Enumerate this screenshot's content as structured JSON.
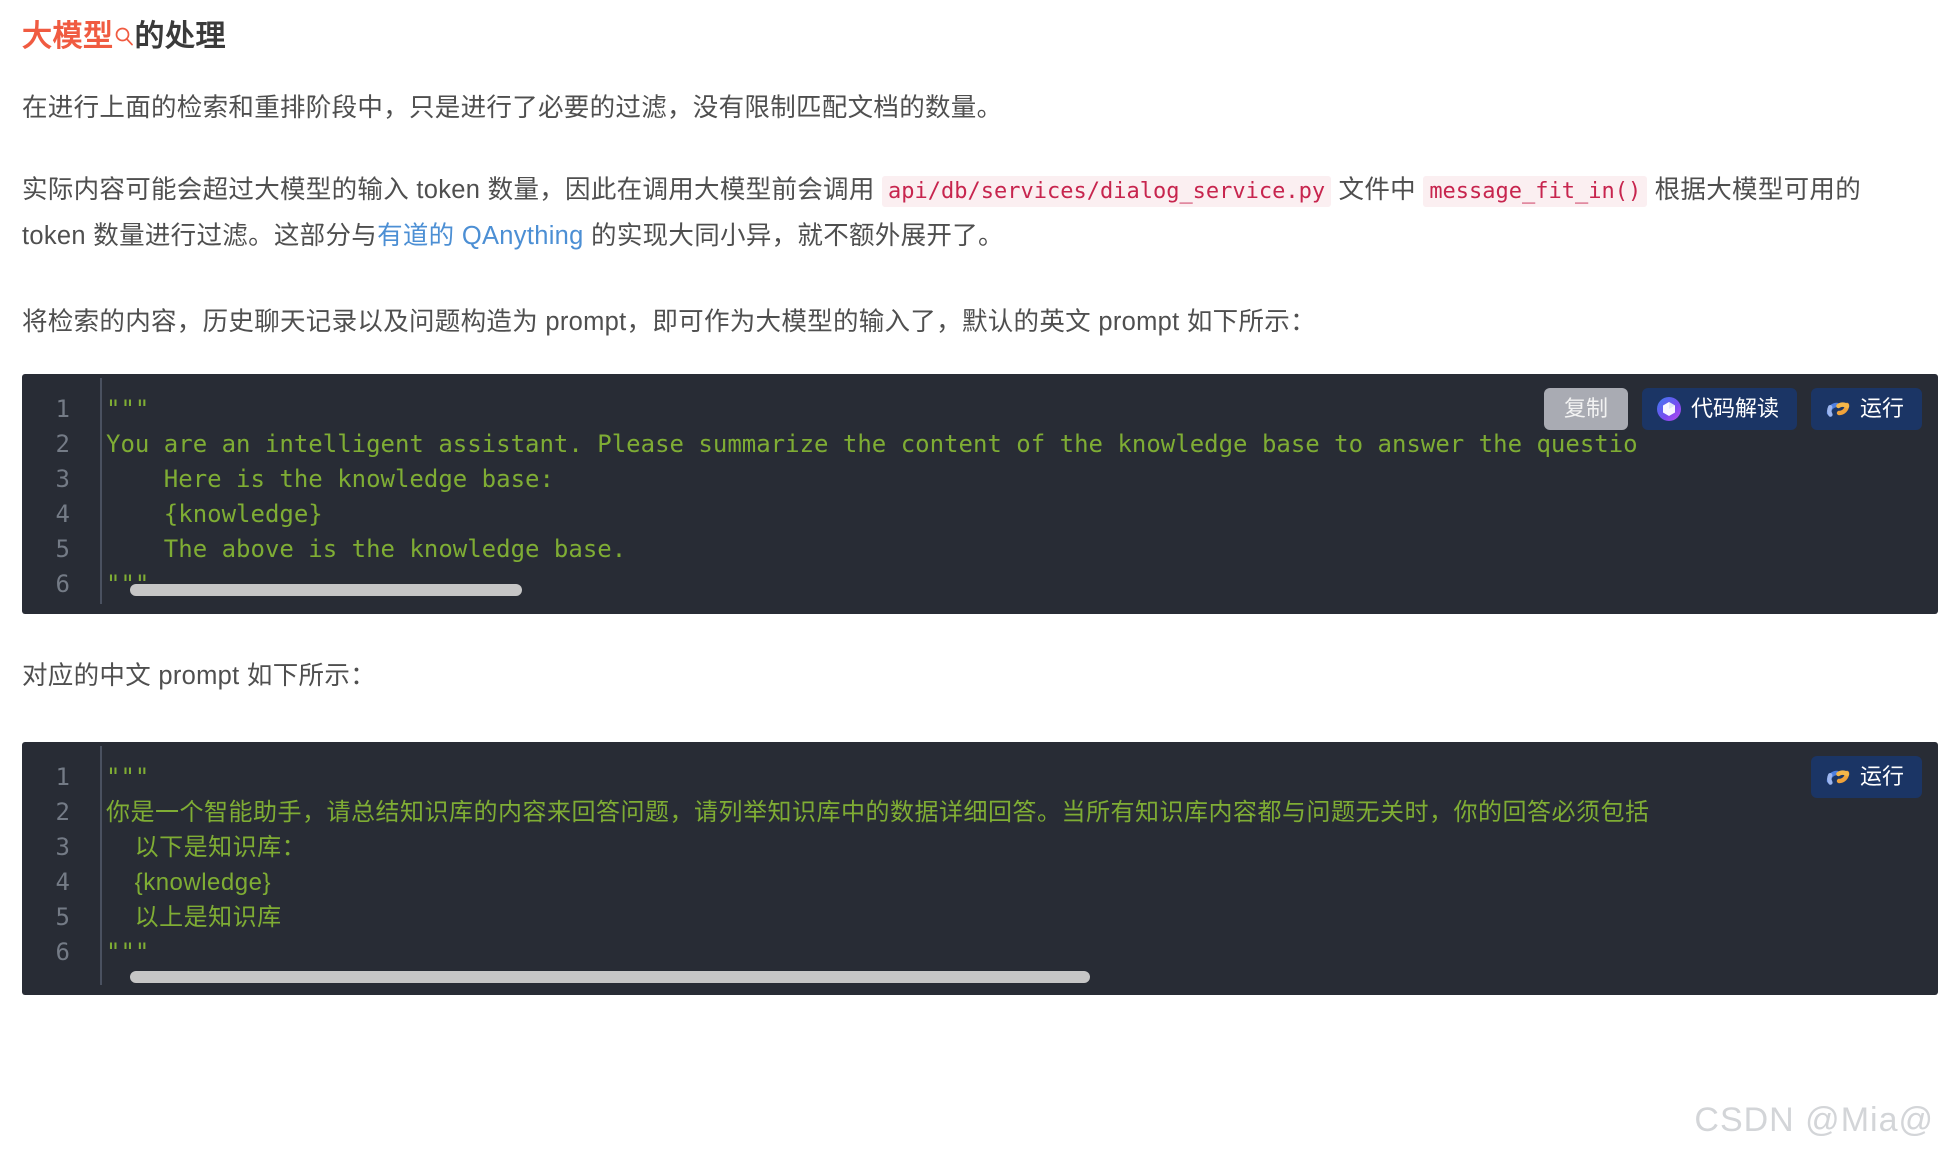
{
  "heading": {
    "highlight": "大模型",
    "icon": "search-icon",
    "rest": "的处理"
  },
  "paragraphs": {
    "p1": "在进行上面的检索和重排阶段中，只是进行了必要的过滤，没有限制匹配文档的数量。",
    "p2_a": "实际内容可能会超过大模型的输入 token 数量，因此在调用大模型前会调用 ",
    "p2_code1": "api/db/services/dialog_service.py",
    "p2_b": " 文件中 ",
    "p2_code2": "message_fit_in()",
    "p2_c": " 根据大模型可用的 token 数量进行过滤。这部分与",
    "p2_link": "有道的 QAnything",
    "p2_d": " 的实现大同小异，就不额外展开了。",
    "p3": "将检索的内容，历史聊天记录以及问题构造为 prompt，即可作为大模型的输入了，默认的英文 prompt 如下所示：",
    "p4": "对应的中文 prompt 如下所示："
  },
  "code_block_1": {
    "toolbar": {
      "copy_label": "复制",
      "explain_label": "代码解读",
      "run_label": "运行"
    },
    "lines": [
      {
        "no": "1",
        "text": "\"\"\""
      },
      {
        "no": "2",
        "text": "You are an intelligent assistant. Please summarize the content of the knowledge base to answer the questio"
      },
      {
        "no": "3",
        "text": "    Here is the knowledge base:"
      },
      {
        "no": "4",
        "text": "    {knowledge}"
      },
      {
        "no": "5",
        "text": "    The above is the knowledge base."
      },
      {
        "no": "6",
        "text": "\"\"\""
      }
    ]
  },
  "code_block_2": {
    "toolbar": {
      "run_label": "运行"
    },
    "lines": [
      {
        "no": "1",
        "text": "\"\"\""
      },
      {
        "no": "2",
        "text": "你是一个智能助手，请总结知识库的内容来回答问题，请列举知识库中的数据详细回答。当所有知识库内容都与问题无关时，你的回答必须包括"
      },
      {
        "no": "3",
        "text": "    以下是知识库："
      },
      {
        "no": "4",
        "text": "    {knowledge}"
      },
      {
        "no": "5",
        "text": "    以上是知识库"
      },
      {
        "no": "6",
        "text": "\"\"\""
      }
    ]
  },
  "watermark": "CSDN @Mia@",
  "colors": {
    "heading_highlight": "#f05b41",
    "code_bg": "#282c35",
    "code_text": "#7fad34",
    "inline_code_text": "#c7254e",
    "inline_code_bg": "#fbeff1",
    "link": "#4c8fd4",
    "button_blue": "#1b3565",
    "button_gray": "#a9abb3"
  }
}
